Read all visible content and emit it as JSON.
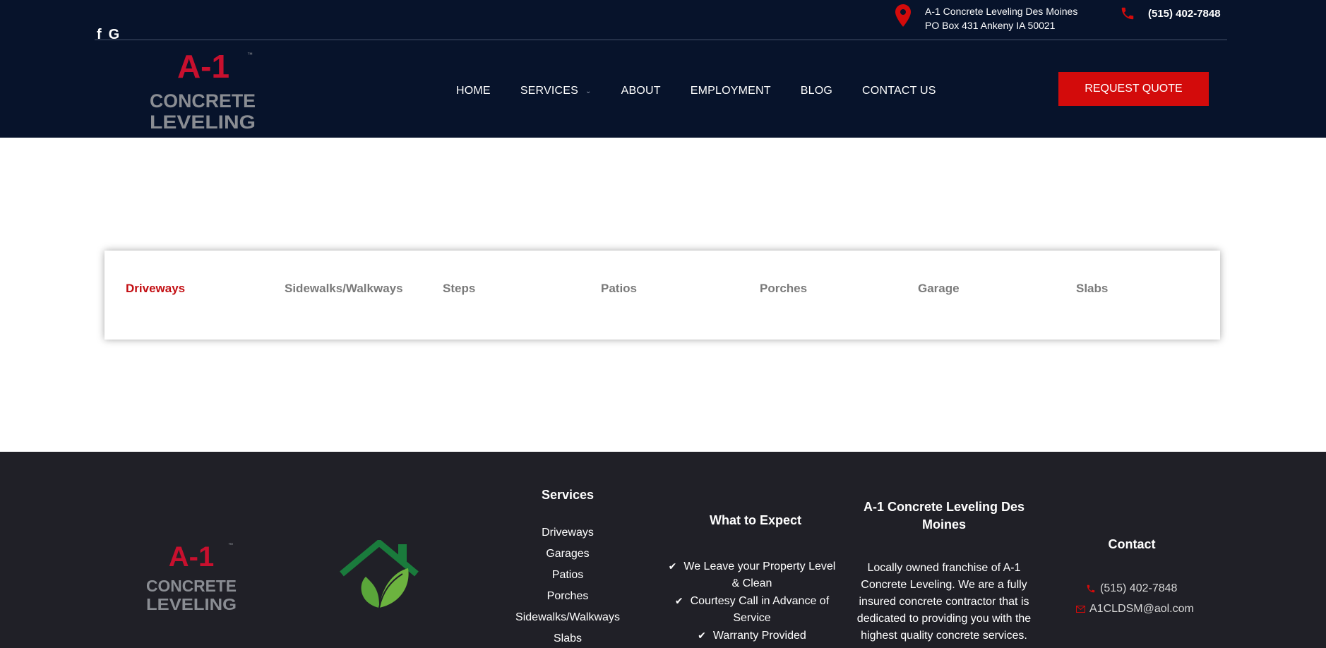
{
  "header": {
    "social": {
      "facebook": "f",
      "google": "G"
    },
    "address_line1": "A-1 Concrete Leveling Des Moines",
    "address_line2": "PO Box 431 Ankeny IA 50021",
    "phone": "(515) 402-7848",
    "logo": {
      "line1": "A-1",
      "tm": "™",
      "line2": "CONCRETE",
      "line3": "LEVELING"
    },
    "nav": [
      {
        "label": "HOME"
      },
      {
        "label": "SERVICES"
      },
      {
        "label": "ABOUT"
      },
      {
        "label": "EMPLOYMENT"
      },
      {
        "label": "BLOG"
      },
      {
        "label": "CONTACT US"
      }
    ],
    "quote_button": "REQUEST QUOTE",
    "colors": {
      "background": "#07132b",
      "accent": "#d30b0b"
    }
  },
  "tabs": [
    {
      "label": "Driveways",
      "active": true
    },
    {
      "label": "Sidewalks/Walkways"
    },
    {
      "label": "Steps"
    },
    {
      "label": "Patios"
    },
    {
      "label": "Porches"
    },
    {
      "label": "Garage"
    },
    {
      "label": "Slabs"
    }
  ],
  "footer": {
    "services_title": "Services",
    "services": [
      "Driveways",
      "Garages",
      "Patios",
      "Porches",
      "Sidewalks/Walkways",
      "Slabs"
    ],
    "expect_title": "What to Expect",
    "expect": [
      "We Leave your Property Level & Clean",
      "Courtesy Call in Advance of Service",
      "Warranty Provided"
    ],
    "about_title": "A-1 Concrete Leveling Des Moines",
    "about_text": "Locally owned franchise of A-1 Concrete Leveling. We are a fully insured concrete contractor that is dedicated to providing you with the highest quality concrete services.",
    "contact_title": "Contact",
    "contact_phone": "(515) 402-7848",
    "contact_email": "A1CLDSM@aol.com",
    "colors": {
      "background": "#202027"
    }
  }
}
